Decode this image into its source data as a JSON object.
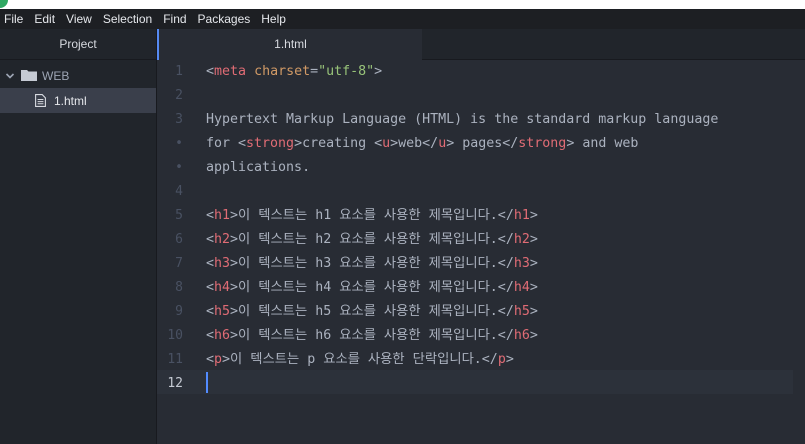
{
  "menubar": {
    "items": [
      "File",
      "Edit",
      "View",
      "Selection",
      "Find",
      "Packages",
      "Help"
    ]
  },
  "sidebar": {
    "title": "Project",
    "folder": "WEB",
    "file": "1.html"
  },
  "tab": {
    "title": "1.html"
  },
  "editor": {
    "line_numbers": [
      "1",
      "2",
      "3",
      "•",
      "•",
      "4",
      "5",
      "6",
      "7",
      "8",
      "9",
      "10",
      "11",
      "12"
    ],
    "active_line": "12",
    "lines": [
      [
        {
          "t": "<",
          "c": ""
        },
        {
          "t": "meta",
          "c": "tag"
        },
        {
          "t": " ",
          "c": ""
        },
        {
          "t": "charset",
          "c": "attr"
        },
        {
          "t": "=",
          "c": ""
        },
        {
          "t": "\"utf-8\"",
          "c": "str"
        },
        {
          "t": ">",
          "c": ""
        }
      ],
      [],
      [
        {
          "t": "Hypertext Markup Language (HTML) is the standard markup language",
          "c": ""
        }
      ],
      [
        {
          "t": "for <",
          "c": ""
        },
        {
          "t": "strong",
          "c": "tag"
        },
        {
          "t": ">creating <",
          "c": ""
        },
        {
          "t": "u",
          "c": "tag"
        },
        {
          "t": ">web</",
          "c": ""
        },
        {
          "t": "u",
          "c": "tag"
        },
        {
          "t": "> pages</",
          "c": ""
        },
        {
          "t": "strong",
          "c": "tag"
        },
        {
          "t": "> and web",
          "c": ""
        }
      ],
      [
        {
          "t": "applications.",
          "c": ""
        }
      ],
      [],
      [
        {
          "t": "<",
          "c": ""
        },
        {
          "t": "h1",
          "c": "tag"
        },
        {
          "t": ">이 텍스트는 h1 요소를 사용한 제목입니다.</",
          "c": ""
        },
        {
          "t": "h1",
          "c": "tag"
        },
        {
          "t": ">",
          "c": ""
        }
      ],
      [
        {
          "t": "<",
          "c": ""
        },
        {
          "t": "h2",
          "c": "tag"
        },
        {
          "t": ">이 텍스트는 h2 요소를 사용한 제목입니다.</",
          "c": ""
        },
        {
          "t": "h2",
          "c": "tag"
        },
        {
          "t": ">",
          "c": ""
        }
      ],
      [
        {
          "t": "<",
          "c": ""
        },
        {
          "t": "h3",
          "c": "tag"
        },
        {
          "t": ">이 텍스트는 h3 요소를 사용한 제목입니다.</",
          "c": ""
        },
        {
          "t": "h3",
          "c": "tag"
        },
        {
          "t": ">",
          "c": ""
        }
      ],
      [
        {
          "t": "<",
          "c": ""
        },
        {
          "t": "h4",
          "c": "tag"
        },
        {
          "t": ">이 텍스트는 h4 요소를 사용한 제목입니다.</",
          "c": ""
        },
        {
          "t": "h4",
          "c": "tag"
        },
        {
          "t": ">",
          "c": ""
        }
      ],
      [
        {
          "t": "<",
          "c": ""
        },
        {
          "t": "h5",
          "c": "tag"
        },
        {
          "t": ">이 텍스트는 h5 요소를 사용한 제목입니다.</",
          "c": ""
        },
        {
          "t": "h5",
          "c": "tag"
        },
        {
          "t": ">",
          "c": ""
        }
      ],
      [
        {
          "t": "<",
          "c": ""
        },
        {
          "t": "h6",
          "c": "tag"
        },
        {
          "t": ">이 텍스트는 h6 요소를 사용한 제목입니다.</",
          "c": ""
        },
        {
          "t": "h6",
          "c": "tag"
        },
        {
          "t": ">",
          "c": ""
        }
      ],
      [
        {
          "t": "<",
          "c": ""
        },
        {
          "t": "p",
          "c": "tag"
        },
        {
          "t": ">이 텍스트는 p 요소를 사용한 단락입니다.</",
          "c": ""
        },
        {
          "t": "p",
          "c": "tag"
        },
        {
          "t": ">",
          "c": ""
        }
      ],
      []
    ]
  },
  "colors": {
    "editor_bg": "#282c34",
    "sidebar_bg": "#21252b",
    "tag": "#e06c75",
    "attribute": "#d19a66",
    "string": "#98c379",
    "text": "#abb2bf",
    "accent": "#568af2"
  },
  "icons": {
    "folder": "folder-icon",
    "file": "file-text-icon",
    "expand": "chevron-down-icon"
  }
}
